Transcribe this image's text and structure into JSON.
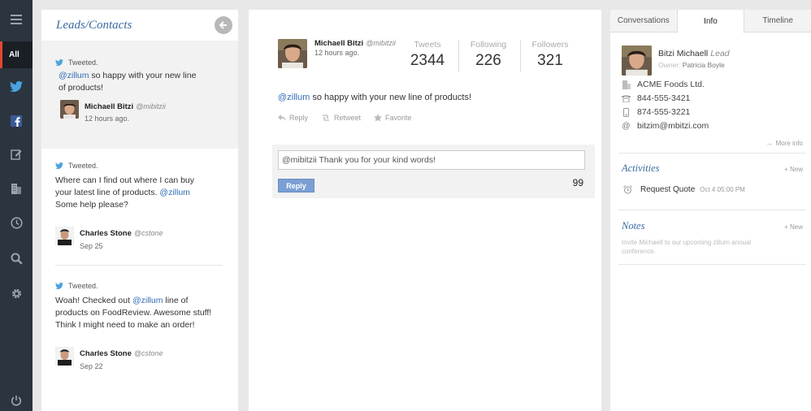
{
  "nav": {
    "all_label": "All"
  },
  "leads": {
    "title": "Leads/Contacts",
    "cards": [
      {
        "tweeted": "Tweeted.",
        "mention": "@zillum",
        "text_after": " so happy with your new line of products!",
        "name": "Michaell Bitzi",
        "handle": "@mibitzii",
        "time": "12 hours ago."
      },
      {
        "tweeted": "Tweeted.",
        "text_before": "Where can I find out where I can buy your latest line of products. ",
        "mention": "@zillum",
        "text_after": " Some help please?",
        "name": "Charles Stone",
        "handle": "@cstone",
        "time": "Sep 25"
      },
      {
        "tweeted": "Tweeted.",
        "text_before": "Woah! Checked out ",
        "mention": "@zillum",
        "text_after": " line of products on FoodReview. Awesome stuff! Think I might need to make an order!",
        "name": "Charles Stone",
        "handle": "@cstone",
        "time": "Sep 22"
      }
    ]
  },
  "detail": {
    "name": "Michaell Bitzi",
    "handle": "@mibitzii",
    "time": "12 hours ago.",
    "stats": [
      {
        "label": "Tweets",
        "value": "2344"
      },
      {
        "label": "Following",
        "value": "226"
      },
      {
        "label": "Followers",
        "value": "321"
      }
    ],
    "tweet_mention": "@zillum",
    "tweet_text": " so happy with your new line of products!",
    "actions": {
      "reply": "Reply",
      "retweet": "Retweet",
      "favorite": "Favorite"
    },
    "reply_value": "@mibitzii Thank you for your kind words!",
    "reply_button": "Reply",
    "char_count": "99"
  },
  "info": {
    "tabs": [
      "Conversations",
      "Info",
      "Timeline"
    ],
    "active_tab": "Info",
    "name": "Bitzi Michaell",
    "tag": "Lead",
    "owner_label": "Owner:",
    "owner": "Patricia Boyle",
    "company": "ACME Foods Ltd.",
    "phone": "844-555-3421",
    "mobile": "874-555-3221",
    "email": "bitzim@mbitzi.com",
    "more_info": "More info",
    "activities_title": "Activities",
    "activities_new": "+ New",
    "activity": {
      "label": "Request Quote",
      "when": "Oct 4 05:00 PM"
    },
    "notes_title": "Notes",
    "notes_new": "+ New",
    "note": "Invite Michaell to our upcoming zillum annual conference."
  },
  "colors": {
    "accent": "#3b6aa0",
    "twitter": "#4aa3df",
    "rail": "#2b3540",
    "button": "#7b9fd4"
  }
}
